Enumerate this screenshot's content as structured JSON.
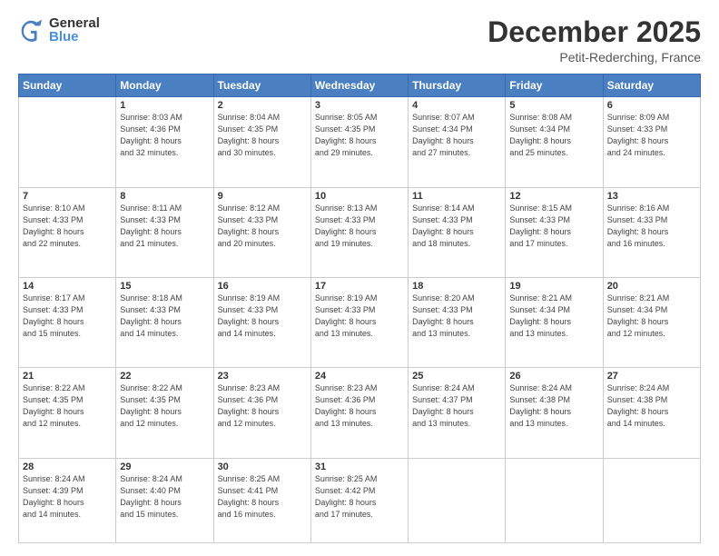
{
  "logo": {
    "general": "General",
    "blue": "Blue"
  },
  "header": {
    "month": "December 2025",
    "location": "Petit-Rederching, France"
  },
  "days_of_week": [
    "Sunday",
    "Monday",
    "Tuesday",
    "Wednesday",
    "Thursday",
    "Friday",
    "Saturday"
  ],
  "weeks": [
    [
      {
        "day": "",
        "info": ""
      },
      {
        "day": "1",
        "info": "Sunrise: 8:03 AM\nSunset: 4:36 PM\nDaylight: 8 hours\nand 32 minutes."
      },
      {
        "day": "2",
        "info": "Sunrise: 8:04 AM\nSunset: 4:35 PM\nDaylight: 8 hours\nand 30 minutes."
      },
      {
        "day": "3",
        "info": "Sunrise: 8:05 AM\nSunset: 4:35 PM\nDaylight: 8 hours\nand 29 minutes."
      },
      {
        "day": "4",
        "info": "Sunrise: 8:07 AM\nSunset: 4:34 PM\nDaylight: 8 hours\nand 27 minutes."
      },
      {
        "day": "5",
        "info": "Sunrise: 8:08 AM\nSunset: 4:34 PM\nDaylight: 8 hours\nand 25 minutes."
      },
      {
        "day": "6",
        "info": "Sunrise: 8:09 AM\nSunset: 4:33 PM\nDaylight: 8 hours\nand 24 minutes."
      }
    ],
    [
      {
        "day": "7",
        "info": "Sunrise: 8:10 AM\nSunset: 4:33 PM\nDaylight: 8 hours\nand 22 minutes."
      },
      {
        "day": "8",
        "info": "Sunrise: 8:11 AM\nSunset: 4:33 PM\nDaylight: 8 hours\nand 21 minutes."
      },
      {
        "day": "9",
        "info": "Sunrise: 8:12 AM\nSunset: 4:33 PM\nDaylight: 8 hours\nand 20 minutes."
      },
      {
        "day": "10",
        "info": "Sunrise: 8:13 AM\nSunset: 4:33 PM\nDaylight: 8 hours\nand 19 minutes."
      },
      {
        "day": "11",
        "info": "Sunrise: 8:14 AM\nSunset: 4:33 PM\nDaylight: 8 hours\nand 18 minutes."
      },
      {
        "day": "12",
        "info": "Sunrise: 8:15 AM\nSunset: 4:33 PM\nDaylight: 8 hours\nand 17 minutes."
      },
      {
        "day": "13",
        "info": "Sunrise: 8:16 AM\nSunset: 4:33 PM\nDaylight: 8 hours\nand 16 minutes."
      }
    ],
    [
      {
        "day": "14",
        "info": "Sunrise: 8:17 AM\nSunset: 4:33 PM\nDaylight: 8 hours\nand 15 minutes."
      },
      {
        "day": "15",
        "info": "Sunrise: 8:18 AM\nSunset: 4:33 PM\nDaylight: 8 hours\nand 14 minutes."
      },
      {
        "day": "16",
        "info": "Sunrise: 8:19 AM\nSunset: 4:33 PM\nDaylight: 8 hours\nand 14 minutes."
      },
      {
        "day": "17",
        "info": "Sunrise: 8:19 AM\nSunset: 4:33 PM\nDaylight: 8 hours\nand 13 minutes."
      },
      {
        "day": "18",
        "info": "Sunrise: 8:20 AM\nSunset: 4:33 PM\nDaylight: 8 hours\nand 13 minutes."
      },
      {
        "day": "19",
        "info": "Sunrise: 8:21 AM\nSunset: 4:34 PM\nDaylight: 8 hours\nand 13 minutes."
      },
      {
        "day": "20",
        "info": "Sunrise: 8:21 AM\nSunset: 4:34 PM\nDaylight: 8 hours\nand 12 minutes."
      }
    ],
    [
      {
        "day": "21",
        "info": "Sunrise: 8:22 AM\nSunset: 4:35 PM\nDaylight: 8 hours\nand 12 minutes."
      },
      {
        "day": "22",
        "info": "Sunrise: 8:22 AM\nSunset: 4:35 PM\nDaylight: 8 hours\nand 12 minutes."
      },
      {
        "day": "23",
        "info": "Sunrise: 8:23 AM\nSunset: 4:36 PM\nDaylight: 8 hours\nand 12 minutes."
      },
      {
        "day": "24",
        "info": "Sunrise: 8:23 AM\nSunset: 4:36 PM\nDaylight: 8 hours\nand 13 minutes."
      },
      {
        "day": "25",
        "info": "Sunrise: 8:24 AM\nSunset: 4:37 PM\nDaylight: 8 hours\nand 13 minutes."
      },
      {
        "day": "26",
        "info": "Sunrise: 8:24 AM\nSunset: 4:38 PM\nDaylight: 8 hours\nand 13 minutes."
      },
      {
        "day": "27",
        "info": "Sunrise: 8:24 AM\nSunset: 4:38 PM\nDaylight: 8 hours\nand 14 minutes."
      }
    ],
    [
      {
        "day": "28",
        "info": "Sunrise: 8:24 AM\nSunset: 4:39 PM\nDaylight: 8 hours\nand 14 minutes."
      },
      {
        "day": "29",
        "info": "Sunrise: 8:24 AM\nSunset: 4:40 PM\nDaylight: 8 hours\nand 15 minutes."
      },
      {
        "day": "30",
        "info": "Sunrise: 8:25 AM\nSunset: 4:41 PM\nDaylight: 8 hours\nand 16 minutes."
      },
      {
        "day": "31",
        "info": "Sunrise: 8:25 AM\nSunset: 4:42 PM\nDaylight: 8 hours\nand 17 minutes."
      },
      {
        "day": "",
        "info": ""
      },
      {
        "day": "",
        "info": ""
      },
      {
        "day": "",
        "info": ""
      }
    ]
  ]
}
